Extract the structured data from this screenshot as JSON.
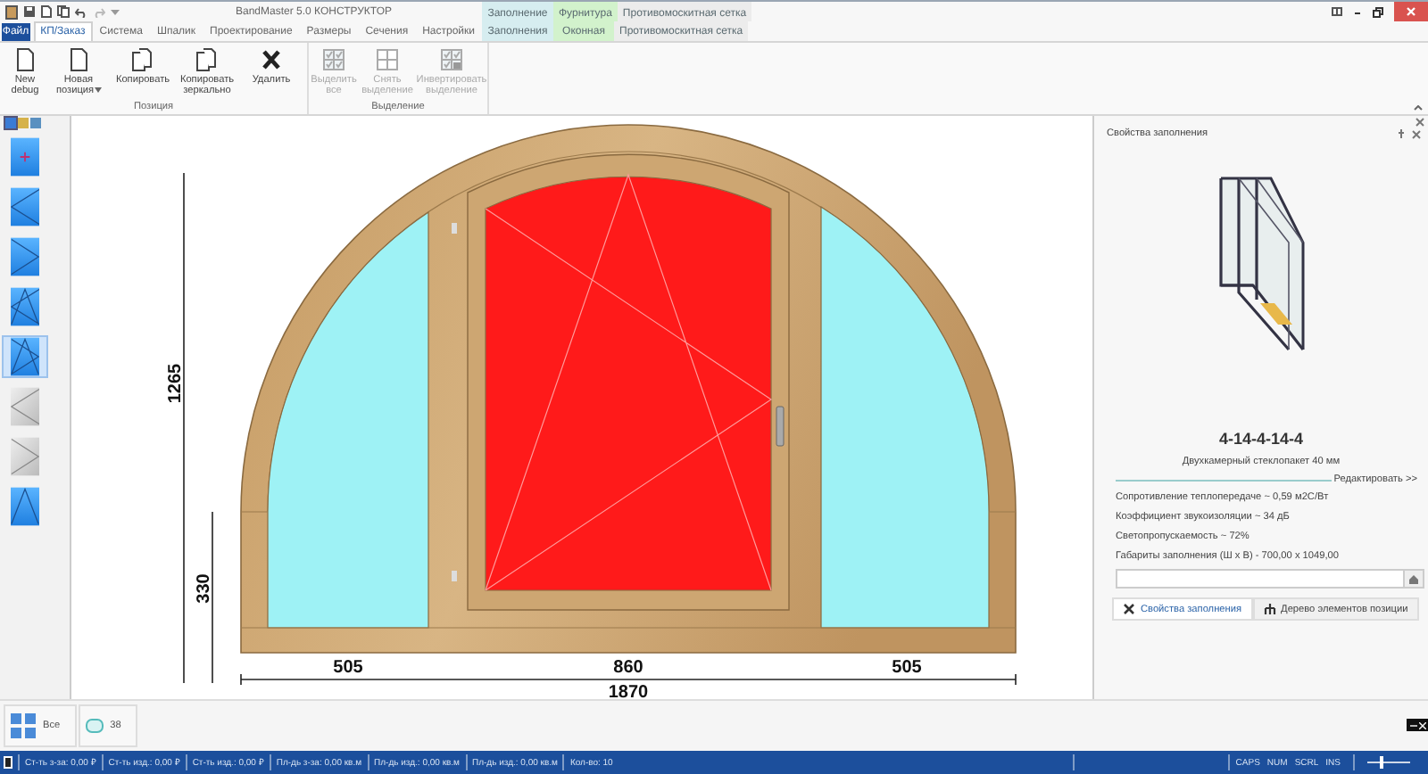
{
  "title_bar": {
    "title": "BandMaster 5.0 КОНСТРУКТОР",
    "context_groups": [
      {
        "label": "Заполнение",
        "color": "#d6edf0"
      },
      {
        "label": "Фурнитура",
        "color": "#d2f2cc"
      },
      {
        "label": "Противомоскитная сетка",
        "color": "#ececec"
      }
    ]
  },
  "ribbon": {
    "file_button": "Файл",
    "tabs": [
      {
        "label": "КП/Заказ",
        "selected": true
      },
      {
        "label": "Система",
        "selected": false
      },
      {
        "label": "Шпалик",
        "selected": false
      },
      {
        "label": "Проектирование",
        "selected": false
      },
      {
        "label": "Размеры",
        "selected": false
      },
      {
        "label": "Сечения",
        "selected": false
      },
      {
        "label": "Настройки",
        "selected": false
      }
    ],
    "context_tabs": [
      {
        "label": "Заполнения",
        "selected": false,
        "color": "#d6edf0"
      },
      {
        "label": "Оконная",
        "selected": false,
        "color": "#d2f2cc"
      },
      {
        "label": "Противомоскитная сетка",
        "selected": false,
        "color": "#ececec"
      }
    ],
    "groups": [
      {
        "label": "Позиция",
        "buttons": [
          {
            "label": "New debug",
            "kind": "document",
            "disabled": false,
            "has_menu": false
          },
          {
            "label": "Новая позиция",
            "kind": "document",
            "disabled": false,
            "has_menu": true
          },
          {
            "label": "Копировать",
            "kind": "copy",
            "disabled": false,
            "has_menu": false
          },
          {
            "label": "Копировать зеркально",
            "kind": "copy",
            "disabled": false,
            "has_menu": false
          },
          {
            "label": "Удалить",
            "kind": "delete",
            "disabled": false,
            "has_menu": false
          }
        ]
      },
      {
        "label": "Выделение",
        "buttons": [
          {
            "label": "Выделить все",
            "kind": "select-all",
            "disabled": true,
            "has_menu": false
          },
          {
            "label": "Снять выделение",
            "kind": "select-none",
            "disabled": true,
            "has_menu": false
          },
          {
            "label": "Инвертировать выделение",
            "kind": "select-invert",
            "disabled": true,
            "has_menu": false
          }
        ]
      }
    ]
  },
  "toolbox": {
    "tabs": [
      {
        "selected": true
      },
      {
        "selected": false
      },
      {
        "selected": false
      }
    ],
    "tools": [
      {
        "kind": "add",
        "selected": false,
        "disabled": false
      },
      {
        "kind": "turn-left",
        "selected": false,
        "disabled": false
      },
      {
        "kind": "turn-right",
        "selected": false,
        "disabled": false
      },
      {
        "kind": "tilt-turn-left",
        "selected": false,
        "disabled": false
      },
      {
        "kind": "tilt-turn-right",
        "selected": true,
        "disabled": false
      },
      {
        "kind": "turn-left",
        "selected": false,
        "disabled": true
      },
      {
        "kind": "turn-right",
        "selected": false,
        "disabled": true
      },
      {
        "kind": "tilt",
        "selected": false,
        "disabled": false
      }
    ]
  },
  "canvas": {
    "height_total": "1265",
    "height_lower": "330",
    "widths": [
      "505",
      "860",
      "505"
    ],
    "width_total": "1870"
  },
  "properties_panel": {
    "title": "Свойства заполнения",
    "glass_code": "4-14-4-14-4",
    "glass_name": "Двухкамерный стеклопакет 40 мм",
    "edit_link": "Редактировать >>",
    "properties": [
      "Сопротивление теплопередаче ~ 0,59 м2С/Вт",
      "Коэффициент звукоизоляции ~ 34 дБ",
      "Светопропускаемость  ~ 72%",
      "Габариты заполнения (Ш x В) - 700,00 x 1049,00"
    ],
    "tabs": [
      {
        "label": "Свойства заполнения",
        "selected": true
      },
      {
        "label": "Дерево элементов позиции",
        "selected": false
      }
    ]
  },
  "bottom_bar": {
    "items": [
      {
        "label": "Все",
        "kind": "all"
      },
      {
        "label": "38",
        "kind": "window"
      }
    ]
  },
  "status_bar": {
    "fields": [
      "Ст-ть з-за: 0,00 ₽",
      "Ст-ть изд.: 0,00 ₽",
      "Ст-ть изд.: 0,00 ₽",
      "Пл-дь з-за: 0,00 кв.м",
      "Пл-дь изд.: 0,00 кв.м",
      "Пл-дь изд.: 0,00 кв.м",
      "Кол-во: 10"
    ],
    "indicators": [
      "CAPS",
      "NUM",
      "SCRL",
      "INS"
    ],
    "zoom": {
      "level": 0.3
    }
  }
}
